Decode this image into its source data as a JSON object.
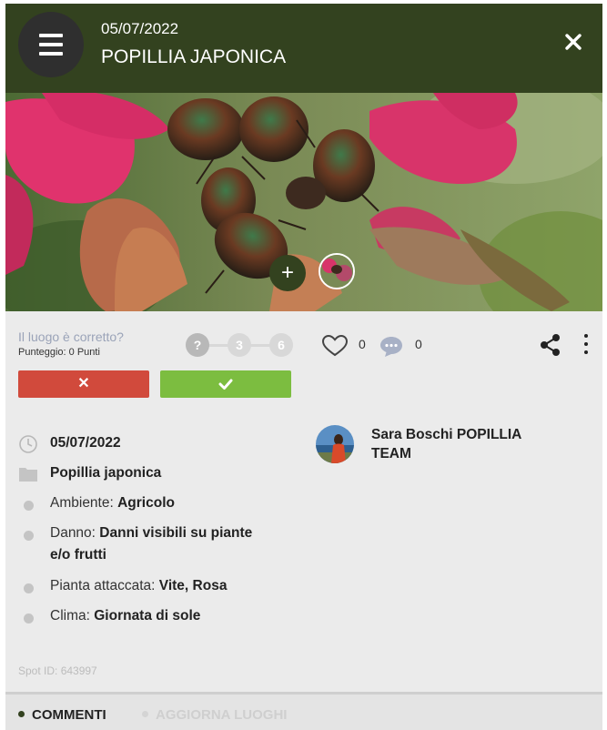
{
  "header": {
    "date": "05/07/2022",
    "title": "POPILLIA JAPONICA",
    "menu_icon": "hamburger-icon",
    "close_icon": "close-icon",
    "background": "#33421f"
  },
  "photo": {
    "add_label": "+",
    "thumbnail_icon": "photo-thumbnail"
  },
  "verification": {
    "question": "Il luogo è corretto?",
    "score": "Punteggio: 0 Punti",
    "steps": [
      "?",
      "3",
      "6"
    ],
    "reject_label": "✕",
    "confirm_icon": "checkmark-icon",
    "reject_color": "#d14a3c",
    "confirm_color": "#7cbd40"
  },
  "stats": {
    "likes": "0",
    "comments": "0",
    "like_icon": "heart-icon",
    "comment_icon": "comment-icon",
    "share_icon": "share-icon",
    "more_icon": "kebab-menu-icon"
  },
  "details": {
    "date": "05/07/2022",
    "category": "Popillia japonica",
    "ambiente_label": "Ambiente: ",
    "ambiente_value": "Agricolo",
    "danno_label": "Danno: ",
    "danno_value_line1": "Danni visibili su piante",
    "danno_value_line2": "e/o frutti",
    "pianta_label": "Pianta attaccata: ",
    "pianta_value": "Vite, Rosa",
    "clima_label": "Clima: ",
    "clima_value": "Giornata di sole"
  },
  "user": {
    "name_line1": "Sara Boschi POPILLIA",
    "name_line2": "TEAM"
  },
  "spot_id": "Spot ID: 643997",
  "tabs": [
    {
      "label": "COMMENTI",
      "active": true
    },
    {
      "label": "AGGIORNA LUOGHI",
      "active": false
    }
  ]
}
